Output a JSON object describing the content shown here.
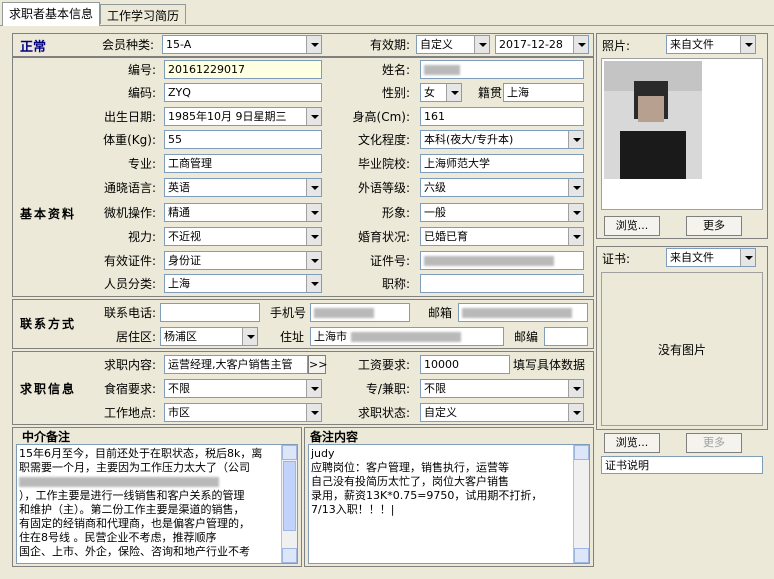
{
  "tabs": [
    {
      "label": "求职者基本信息"
    },
    {
      "label": "工作学习简历"
    }
  ],
  "status": "正常",
  "member": {
    "label": "会员种类:",
    "value": "15-A"
  },
  "validity": {
    "label": "有效期:",
    "mode": "自定义",
    "date": "2017-12-28"
  },
  "sections": {
    "basic": "基本资料",
    "contact": "联系方式",
    "job": "求职信息"
  },
  "basic": {
    "id_label": "编号:",
    "id_value": "20161229017",
    "name_label": "姓名:",
    "code_label": "编码:",
    "code_value": "ZYQ",
    "gender_label": "性别:",
    "gender_value": "女",
    "hometown_label": "籍贯",
    "hometown_value": "上海",
    "birth_label": "出生日期:",
    "birth_value": "1985年10月 9日星期三",
    "height_label": "身高(Cm):",
    "height_value": "161",
    "weight_label": "体重(Kg):",
    "weight_value": "55",
    "edu_label": "文化程度:",
    "edu_value": "本科(夜大/专升本)",
    "major_label": "专业:",
    "major_value": "工商管理",
    "school_label": "毕业院校:",
    "school_value": "上海师范大学",
    "lang_label": "通晓语言:",
    "lang_value": "英语",
    "langlevel_label": "外语等级:",
    "langlevel_value": "六级",
    "pc_label": "微机操作:",
    "pc_value": "精通",
    "look_label": "形象:",
    "look_value": "一般",
    "vision_label": "视力:",
    "vision_value": "不近视",
    "marital_label": "婚育状况:",
    "marital_value": "已婚已育",
    "cert_label": "有效证件:",
    "cert_value": "身份证",
    "certno_label": "证件号:",
    "category_label": "人员分类:",
    "category_value": "上海",
    "title_label": "职称:"
  },
  "contact": {
    "phone_label": "联系电话:",
    "mobile_label": "手机号",
    "email_label": "邮箱",
    "district_label": "居住区:",
    "district_value": "杨浦区",
    "address_label": "住址",
    "address_value": "上海市",
    "zip_label": "邮编"
  },
  "job": {
    "content_label": "求职内容:",
    "content_value": "运营经理,大客户销售主管",
    "more_btn": ">>",
    "salary_label": "工资要求:",
    "salary_value": "10000",
    "salary_note": "填写具体数据",
    "board_label": "食宿要求:",
    "board_value": "不限",
    "parttime_label": "专/兼职:",
    "parttime_value": "不限",
    "location_label": "工作地点:",
    "location_value": "市区",
    "state_label": "求职状态:",
    "state_value": "自定义"
  },
  "agent_note": {
    "title": "中介备注",
    "lines": [
      "15年6月至今，目前还处于在职状态，税后8k，离",
      "职需要一个月，主要因为工作压力太大了（公司",
      "",
      "），工作主要是进行一线销售和客户关系的管理",
      "和维护（主）。第二份工作主要是渠道的销售，",
      "有固定的经销商和代理商，也是偏客户管理的，",
      "住在8号线        。民营企业不考虑，推荐顺序",
      "国企、上市、外企，保险、咨询和地产行业不考"
    ]
  },
  "remark": {
    "title": "备注内容",
    "lines": [
      "judy",
      "应聘岗位：客户管理，销售执行，运营等",
      "自己没有投简历太忙了，岗位大客户销售",
      "",
      "",
      "      录用，薪资13K*0.75=9750，试用期不打折，",
      "7/13入职！！！|"
    ]
  },
  "photo": {
    "label": "照片:",
    "source": "来自文件",
    "browse": "浏览...",
    "more": "更多"
  },
  "certificate": {
    "label": "证书:",
    "source": "来自文件",
    "empty": "没有图片",
    "browse": "浏览...",
    "more": "更多",
    "caption": "证书说明"
  }
}
